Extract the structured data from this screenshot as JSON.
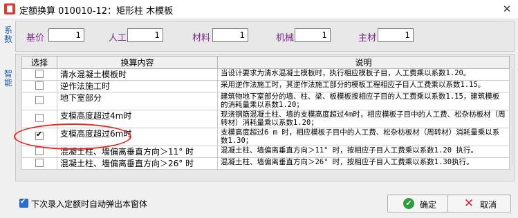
{
  "window": {
    "title": "定额换算  010010-12：矩形柱 木模板"
  },
  "side_tabs": {
    "coefficients": [
      "系",
      "数"
    ],
    "smart": [
      "智",
      "能"
    ]
  },
  "coefficients": [
    {
      "label": "基价",
      "value": "1"
    },
    {
      "label": "人工",
      "value": "1"
    },
    {
      "label": "材料",
      "value": "1"
    },
    {
      "label": "机械",
      "value": "1"
    },
    {
      "label": "主材",
      "value": "1"
    }
  ],
  "table": {
    "headers": {
      "select": "选择",
      "content": "换算内容",
      "description": "说明"
    },
    "rows": [
      {
        "checked": false,
        "name": "清水混凝土模板时",
        "desc": "当设计要求为清水混凝土模板时，执行相应模板子目，人工费乘以系数1.20。"
      },
      {
        "checked": false,
        "name": "逆作法施工时",
        "desc": "采用逆作法施工时，其逆作法施工部分的模板工程相应子目人工费乘以系数1.15。"
      },
      {
        "checked": false,
        "name": "地下室部分",
        "desc": "建筑物地下室部分的墙、柱、梁、板模板按相应子目的人工费乘以系数1.15，建筑模板的消耗量乘以系数1.20；"
      },
      {
        "checked": false,
        "name": "支模高度超过4m时",
        "desc": "现浇钢筋混凝土柱、墙的支模高度超过4m时，相应模板子目中的人工费、松杂枋板材（周转材）消耗量乘以系数1.20；"
      },
      {
        "checked": true,
        "name": "支模高度超过6m时",
        "desc": "支模高度超过6 m 时，相应模板子目中的人工费、松杂枋板材（周转材）消耗量乘以系数1.30；"
      },
      {
        "checked": false,
        "name": "混凝土柱、墙偏离垂直方向＞11° 时",
        "desc": "混凝土柱、墙偏离垂直方向＞11° 时，按相应子目人工费乘以系数1.20 执行。"
      },
      {
        "checked": false,
        "name": "混凝土柱、墙偏离垂直方向＞26° 时",
        "desc": "混凝土柱、墙偏离垂直方向＞26° 时，按相应子目人工费乘以系数1.30执行。"
      }
    ]
  },
  "footer": {
    "auto_popup_checked": true,
    "auto_popup_label": "下次录入定额时自动弹出本窗体",
    "ok_label": "确定",
    "cancel_label": "取消"
  },
  "colors": {
    "accent": "#2a6fd6",
    "label_purple": "#7b2a8c",
    "highlight_red": "#e8261f"
  },
  "icons": {
    "ok": "check-circle-icon",
    "cancel": "x-icon",
    "close": "close-icon"
  }
}
